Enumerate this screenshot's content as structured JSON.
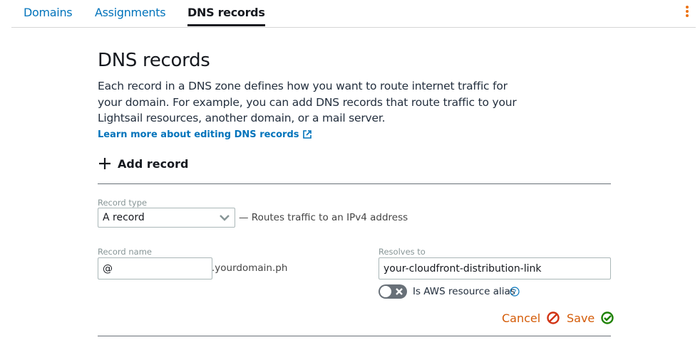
{
  "tabs": [
    {
      "label": "Domains"
    },
    {
      "label": "Assignments"
    },
    {
      "label": "DNS records",
      "active": true
    }
  ],
  "page": {
    "title": "DNS records",
    "description": "Each record in a DNS zone defines how you want to route internet traffic for your domain. For example, you can add DNS records that route traffic to your Lightsail resources, another domain, or a mail server.",
    "learn_more": "Learn more about editing DNS records",
    "add_record": "Add record"
  },
  "form": {
    "record_type_label": "Record type",
    "record_type_value": "A record",
    "record_type_hint": "— Routes traffic to an IPv4 address",
    "record_name_label": "Record name",
    "record_name_value": "@",
    "domain_suffix": ".yourdomain.ph",
    "resolves_to_label": "Resolves to",
    "resolves_to_value": "your-cloudfront-distribution-link",
    "alias_label": "Is AWS resource alias",
    "alias_enabled": false,
    "cancel": "Cancel",
    "save": "Save"
  },
  "colors": {
    "link": "#0073bb",
    "action": "#d45b07",
    "cancel_icon": "#d13212",
    "save_icon": "#1d8102",
    "menu": "#ec7211"
  }
}
